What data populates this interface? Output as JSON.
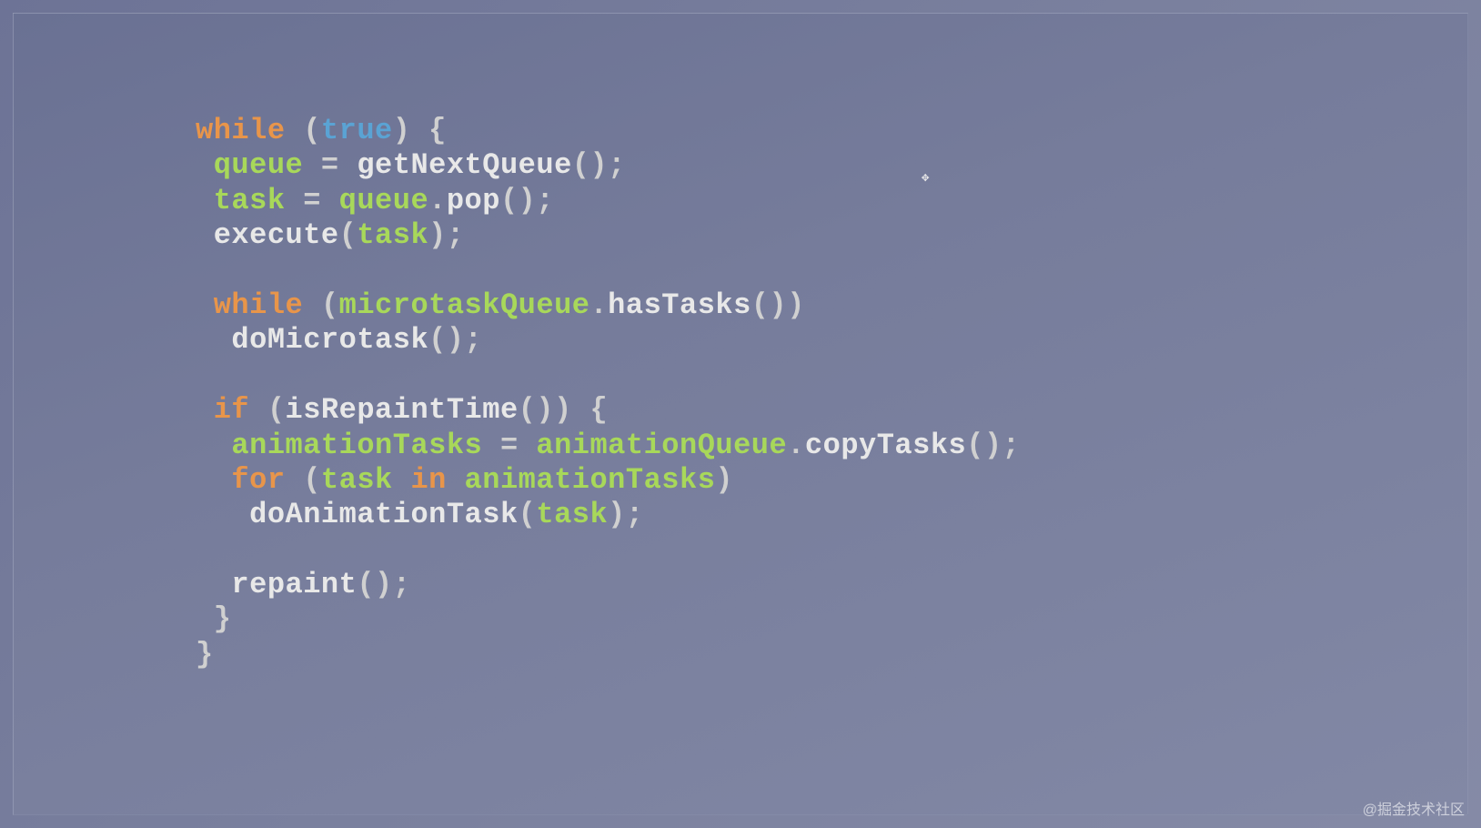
{
  "code": {
    "lines": [
      [
        {
          "cls": "kw",
          "t": "while"
        },
        {
          "cls": "punct",
          "t": " ("
        },
        {
          "cls": "bool",
          "t": "true"
        },
        {
          "cls": "punct",
          "t": ") {"
        }
      ],
      [
        {
          "cls": "punct",
          "t": " "
        },
        {
          "cls": "var",
          "t": "queue"
        },
        {
          "cls": "punct",
          "t": " = "
        },
        {
          "cls": "fn",
          "t": "getNextQueue"
        },
        {
          "cls": "punct",
          "t": "();"
        }
      ],
      [
        {
          "cls": "punct",
          "t": " "
        },
        {
          "cls": "var",
          "t": "task"
        },
        {
          "cls": "punct",
          "t": " = "
        },
        {
          "cls": "var",
          "t": "queue"
        },
        {
          "cls": "punct",
          "t": "."
        },
        {
          "cls": "fn",
          "t": "pop"
        },
        {
          "cls": "punct",
          "t": "();"
        }
      ],
      [
        {
          "cls": "punct",
          "t": " "
        },
        {
          "cls": "fn",
          "t": "execute"
        },
        {
          "cls": "punct",
          "t": "("
        },
        {
          "cls": "var",
          "t": "task"
        },
        {
          "cls": "punct",
          "t": ");"
        }
      ],
      [
        {
          "cls": "punct",
          "t": " "
        }
      ],
      [
        {
          "cls": "punct",
          "t": " "
        },
        {
          "cls": "kw",
          "t": "while"
        },
        {
          "cls": "punct",
          "t": " ("
        },
        {
          "cls": "var",
          "t": "microtaskQueue"
        },
        {
          "cls": "punct",
          "t": "."
        },
        {
          "cls": "fn",
          "t": "hasTasks"
        },
        {
          "cls": "punct",
          "t": "())"
        }
      ],
      [
        {
          "cls": "punct",
          "t": "  "
        },
        {
          "cls": "fn",
          "t": "doMicrotask"
        },
        {
          "cls": "punct",
          "t": "();"
        }
      ],
      [
        {
          "cls": "punct",
          "t": " "
        }
      ],
      [
        {
          "cls": "punct",
          "t": " "
        },
        {
          "cls": "kw",
          "t": "if"
        },
        {
          "cls": "punct",
          "t": " ("
        },
        {
          "cls": "fn",
          "t": "isRepaintTime"
        },
        {
          "cls": "punct",
          "t": "()) {"
        }
      ],
      [
        {
          "cls": "punct",
          "t": "  "
        },
        {
          "cls": "var",
          "t": "animationTasks"
        },
        {
          "cls": "punct",
          "t": " = "
        },
        {
          "cls": "var",
          "t": "animationQueue"
        },
        {
          "cls": "punct",
          "t": "."
        },
        {
          "cls": "fn",
          "t": "copyTasks"
        },
        {
          "cls": "punct",
          "t": "();"
        }
      ],
      [
        {
          "cls": "punct",
          "t": "  "
        },
        {
          "cls": "kw",
          "t": "for"
        },
        {
          "cls": "punct",
          "t": " ("
        },
        {
          "cls": "var",
          "t": "task"
        },
        {
          "cls": "punct",
          "t": " "
        },
        {
          "cls": "kw",
          "t": "in"
        },
        {
          "cls": "punct",
          "t": " "
        },
        {
          "cls": "var",
          "t": "animationTasks"
        },
        {
          "cls": "punct",
          "t": ")"
        }
      ],
      [
        {
          "cls": "punct",
          "t": "   "
        },
        {
          "cls": "fn",
          "t": "doAnimationTask"
        },
        {
          "cls": "punct",
          "t": "("
        },
        {
          "cls": "var",
          "t": "task"
        },
        {
          "cls": "punct",
          "t": ");"
        }
      ],
      [
        {
          "cls": "punct",
          "t": " "
        }
      ],
      [
        {
          "cls": "punct",
          "t": "  "
        },
        {
          "cls": "fn",
          "t": "repaint"
        },
        {
          "cls": "punct",
          "t": "();"
        }
      ],
      [
        {
          "cls": "punct",
          "t": " }"
        }
      ],
      [
        {
          "cls": "punct",
          "t": "}"
        }
      ]
    ]
  },
  "watermark": "@掘金技术社区"
}
